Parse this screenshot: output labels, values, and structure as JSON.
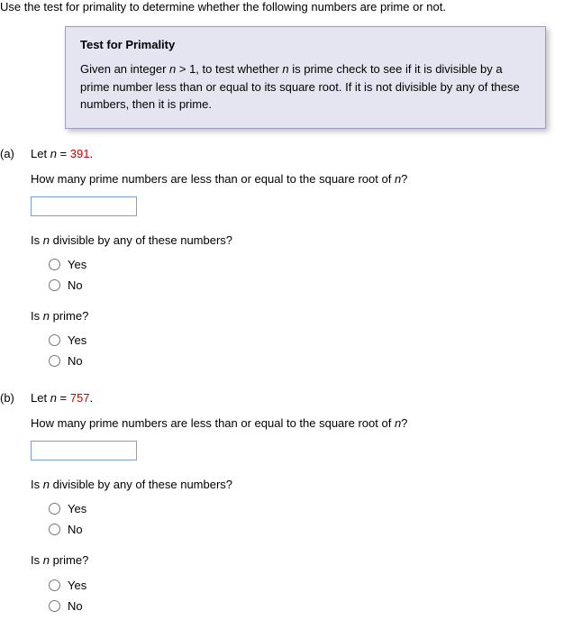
{
  "intro": "Use the test for primality to determine whether the following numbers are prime or not.",
  "theorem": {
    "title": "Test for Primality",
    "body_pre": "Given an integer ",
    "body_cond": " > 1, to test whether ",
    "body_mid": " is prime check to see if it is divisible by a prime number less than or equal to its square root. If it is not divisible by any of these numbers, then it is prime."
  },
  "parts": [
    {
      "label": "(a)",
      "let_pre": "Let ",
      "let_eq": " = ",
      "n_value": "391",
      "q1_pre": "How many prime numbers are less than or equal to the square root of ",
      "q1_post": "?",
      "input_value": "",
      "q2_pre": "Is ",
      "q2_post": " divisible by any of these numbers?",
      "opt_yes": "Yes",
      "opt_no": "No",
      "q3_pre": "Is ",
      "q3_post": " prime?"
    },
    {
      "label": "(b)",
      "let_pre": "Let ",
      "let_eq": " = ",
      "n_value": "757",
      "q1_pre": "How many prime numbers are less than or equal to the square root of ",
      "q1_post": "?",
      "input_value": "",
      "q2_pre": "Is ",
      "q2_post": " divisible by any of these numbers?",
      "opt_yes": "Yes",
      "opt_no": "No",
      "q3_pre": "Is ",
      "q3_post": " prime?"
    }
  ],
  "var_n": "n"
}
